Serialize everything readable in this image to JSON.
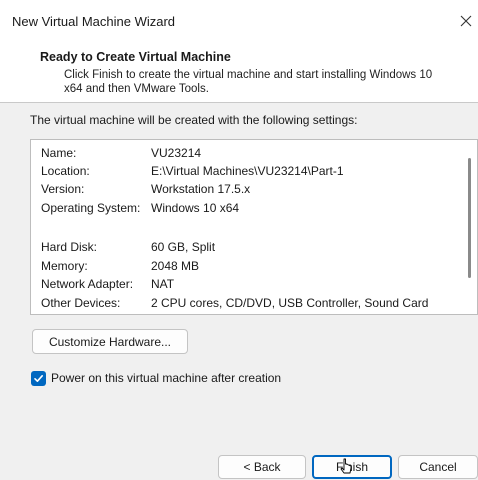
{
  "window": {
    "title": "New Virtual Machine Wizard",
    "close_glyph": "X"
  },
  "header": {
    "title": "Ready to Create Virtual Machine",
    "subtitle_line1": "Click Finish to create the virtual machine and start installing Windows 10",
    "subtitle_line2": "x64 and then VMware Tools."
  },
  "intro_text": "The virtual machine will be created with the following settings:",
  "settings": [
    {
      "key": "Name:",
      "value": "VU23214"
    },
    {
      "key": "Location:",
      "value": "E:\\Virtual Machines\\VU23214\\Part-1"
    },
    {
      "key": "Version:",
      "value": "Workstation 17.5.x"
    },
    {
      "key": "Operating System:",
      "value": "Windows 10 x64"
    },
    {
      "key": "Hard Disk:",
      "value": "60 GB, Split"
    },
    {
      "key": "Memory:",
      "value": "2048 MB"
    },
    {
      "key": "Network Adapter:",
      "value": "NAT"
    },
    {
      "key": "Other Devices:",
      "value": "2 CPU cores, CD/DVD, USB Controller, Sound Card"
    }
  ],
  "buttons": {
    "customize": "Customize Hardware...",
    "back": "< Back",
    "finish": "Finish",
    "cancel": "Cancel"
  },
  "power_on": {
    "label": "Power on this virtual machine after creation",
    "checked": true
  },
  "colors": {
    "accent": "#0067c0"
  }
}
